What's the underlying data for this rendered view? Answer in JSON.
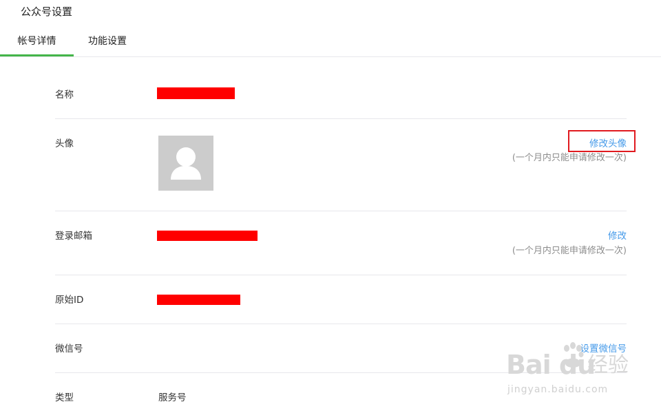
{
  "page": {
    "title": "公众号设置"
  },
  "tabs": [
    {
      "label": "帐号详情",
      "active": true
    },
    {
      "label": "功能设置",
      "active": false
    }
  ],
  "rows": {
    "name": {
      "label": "名称"
    },
    "avatar": {
      "label": "头像",
      "action": "修改头像",
      "hint": "(一个月内只能申请修改一次)"
    },
    "email": {
      "label": "登录邮箱",
      "action": "修改",
      "hint": "(一个月内只能申请修改一次)"
    },
    "original_id": {
      "label": "原始ID"
    },
    "wechat_id": {
      "label": "微信号",
      "action": "设置微信号"
    },
    "type": {
      "label": "类型",
      "value": "服务号"
    }
  },
  "watermark": {
    "logo_text": "Bai du",
    "cn_text": "经验",
    "url": "jingyan.baidu.com"
  },
  "colors": {
    "accent_tab": "#44b549",
    "link": "#459ae9",
    "redaction": "#ff0000",
    "highlight_box": "#e0191e",
    "divider": "#e7e7eb"
  }
}
